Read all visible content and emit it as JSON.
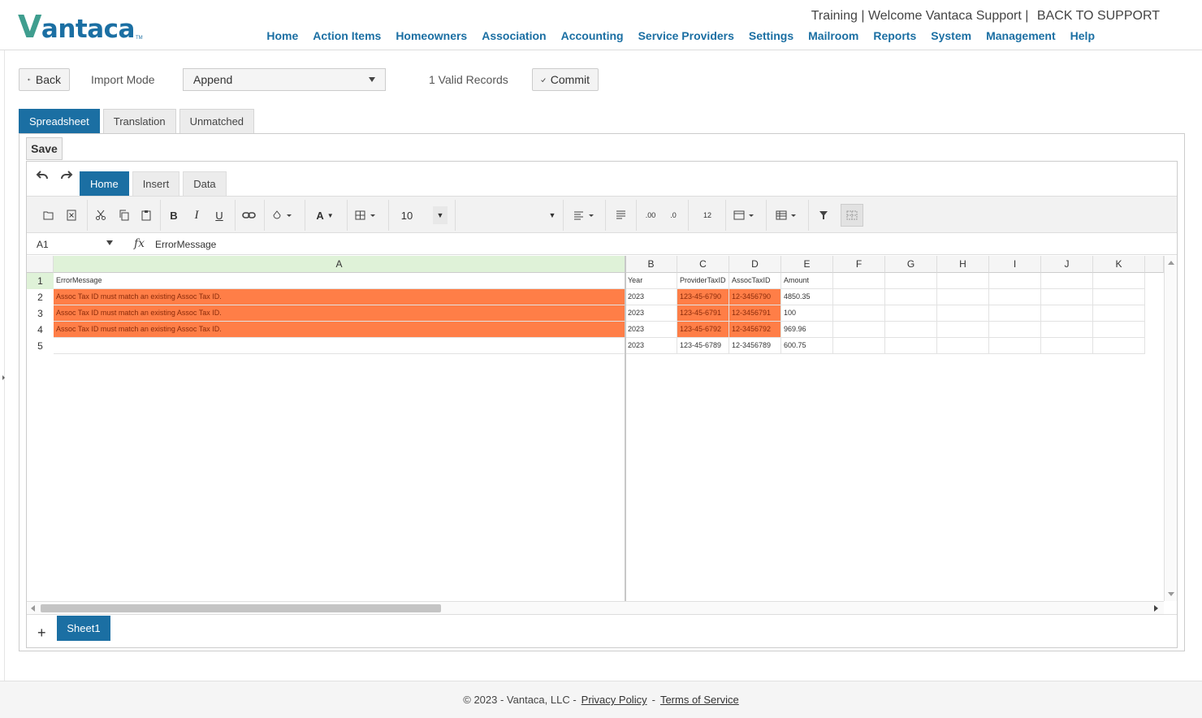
{
  "header": {
    "logo_text": "antaca",
    "logo_initial": "V",
    "logo_tm": "TM",
    "environment": "Training",
    "welcome": "Welcome Vantaca Support",
    "back_to_support": "BACK TO SUPPORT",
    "nav": [
      "Home",
      "Action Items",
      "Homeowners",
      "Association",
      "Accounting",
      "Service Providers",
      "Settings",
      "Mailroom",
      "Reports",
      "System",
      "Management",
      "Help"
    ]
  },
  "toolbar": {
    "back_label": "Back",
    "import_mode_label": "Import Mode",
    "import_mode_value": "Append",
    "valid_records": "1 Valid Records",
    "commit_label": "Commit"
  },
  "tabs": [
    "Spreadsheet",
    "Translation",
    "Unmatched"
  ],
  "active_tab": "Spreadsheet",
  "save_label": "Save",
  "ribbon": {
    "tabs": [
      "Home",
      "Insert",
      "Data"
    ],
    "active": "Home",
    "font_size": "10",
    "number_format_label": "12"
  },
  "formula_bar": {
    "cell_ref": "A1",
    "fx": "fx",
    "value": "ErrorMessage"
  },
  "grid": {
    "columns": [
      "A",
      "B",
      "C",
      "D",
      "E",
      "F",
      "G",
      "H",
      "I",
      "J",
      "K"
    ],
    "rows": [
      "1",
      "2",
      "3",
      "4",
      "5"
    ],
    "header_row": [
      "ErrorMessage",
      "Year",
      "ProviderTaxID",
      "AssocTaxID",
      "Amount"
    ],
    "data": [
      {
        "error": "Assoc Tax ID must match an existing Assoc Tax ID.",
        "year": "2023",
        "provider": "123-45-6790",
        "assoc": "12-3456790",
        "amount": "4850.35",
        "highlight": true
      },
      {
        "error": "Assoc Tax ID must match an existing Assoc Tax ID.",
        "year": "2023",
        "provider": "123-45-6791",
        "assoc": "12-3456791",
        "amount": "100",
        "highlight": true
      },
      {
        "error": "Assoc Tax ID must match an existing Assoc Tax ID.",
        "year": "2023",
        "provider": "123-45-6792",
        "assoc": "12-3456792",
        "amount": "969.96",
        "highlight": true
      },
      {
        "error": "",
        "year": "2023",
        "provider": "123-45-6789",
        "assoc": "12-3456789",
        "amount": "600.75",
        "highlight": false
      }
    ],
    "error_color": "#ff7e47"
  },
  "sheet_tabs": [
    "Sheet1"
  ],
  "add_sheet": "+",
  "footer": {
    "copyright": "© 2023 - Vantaca, LLC -",
    "privacy": "Privacy Policy",
    "sep": "-",
    "terms": "Terms of Service"
  },
  "colors": {
    "brand": "#1b6fa3",
    "logo_v": "#3f9e8f",
    "selected_header": "#dff2d8"
  }
}
